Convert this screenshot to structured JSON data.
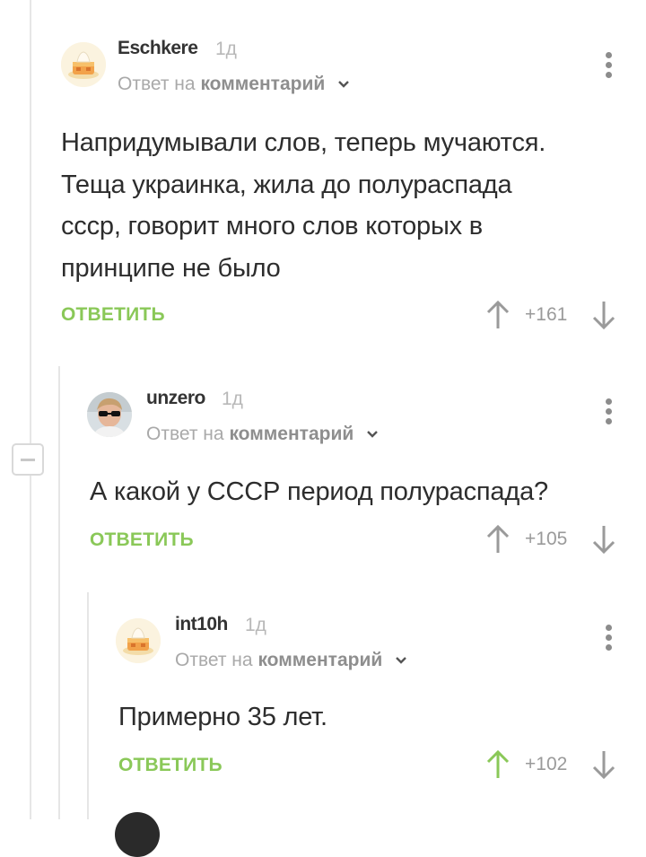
{
  "comments": [
    {
      "username": "Eschkere",
      "time": "1д",
      "reply_prefix": "Ответ на",
      "reply_target": "комментарий",
      "lines": [
        "Напридумывали слов, теперь мучаются.",
        "Теща украинка, жила до полураспада",
        "ссср, говорит много слов которых в",
        "принципе не было"
      ],
      "reply_label": "ОТВЕТИТЬ",
      "score": "+161",
      "avatar": "cake-avatar-icon",
      "upvoted": false
    },
    {
      "username": "unzero",
      "time": "1д",
      "reply_prefix": "Ответ на",
      "reply_target": "комментарий",
      "lines": [
        "А какой у СССР период полураспада?"
      ],
      "reply_label": "ОТВЕТИТЬ",
      "score": "+105",
      "avatar": "user-photo-avatar",
      "upvoted": false
    },
    {
      "username": "int10h",
      "time": "1д",
      "reply_prefix": "Ответ на",
      "reply_target": "комментарий",
      "lines": [
        "Примерно 35 лет."
      ],
      "reply_label": "ОТВЕТИТЬ",
      "score": "+102",
      "avatar": "cake-avatar-icon",
      "upvoted": true
    }
  ],
  "colors": {
    "accent_green": "#8ac858",
    "vote_gray": "#9a9a9a",
    "thread_line": "#e6e6e6"
  }
}
